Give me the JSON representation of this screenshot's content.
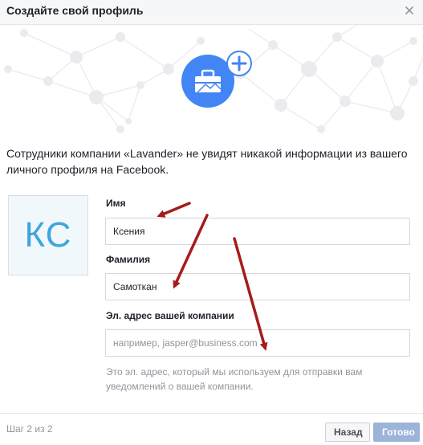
{
  "dialog": {
    "title": "Создайте свой профиль"
  },
  "intro": {
    "text": "Сотрудники компании «Lavander» не увидят никакой информации из вашего личного профиля на Facebook."
  },
  "avatar": {
    "initials": "КС"
  },
  "form": {
    "first_name": {
      "label": "Имя",
      "value": "Ксения"
    },
    "last_name": {
      "label": "Фамилия",
      "value": "Самоткан"
    },
    "work_email": {
      "label": "Эл. адрес вашей компании",
      "value": "",
      "placeholder": "например, jasper@business.com"
    },
    "hint": "Это эл. адрес, который мы используем для отправки вам уведомлений о вашей компании."
  },
  "footer": {
    "step": "Шаг 2 из 2",
    "back_label": "Назад",
    "done_label": "Готово"
  },
  "colors": {
    "accent": "#4285f4",
    "annotation_arrow": "#a51c1c",
    "done_button": "#9cb4d8",
    "initials": "#3ea5de"
  },
  "icons": {
    "close": "close-icon",
    "briefcase": "briefcase-icon",
    "add": "plus-icon"
  }
}
